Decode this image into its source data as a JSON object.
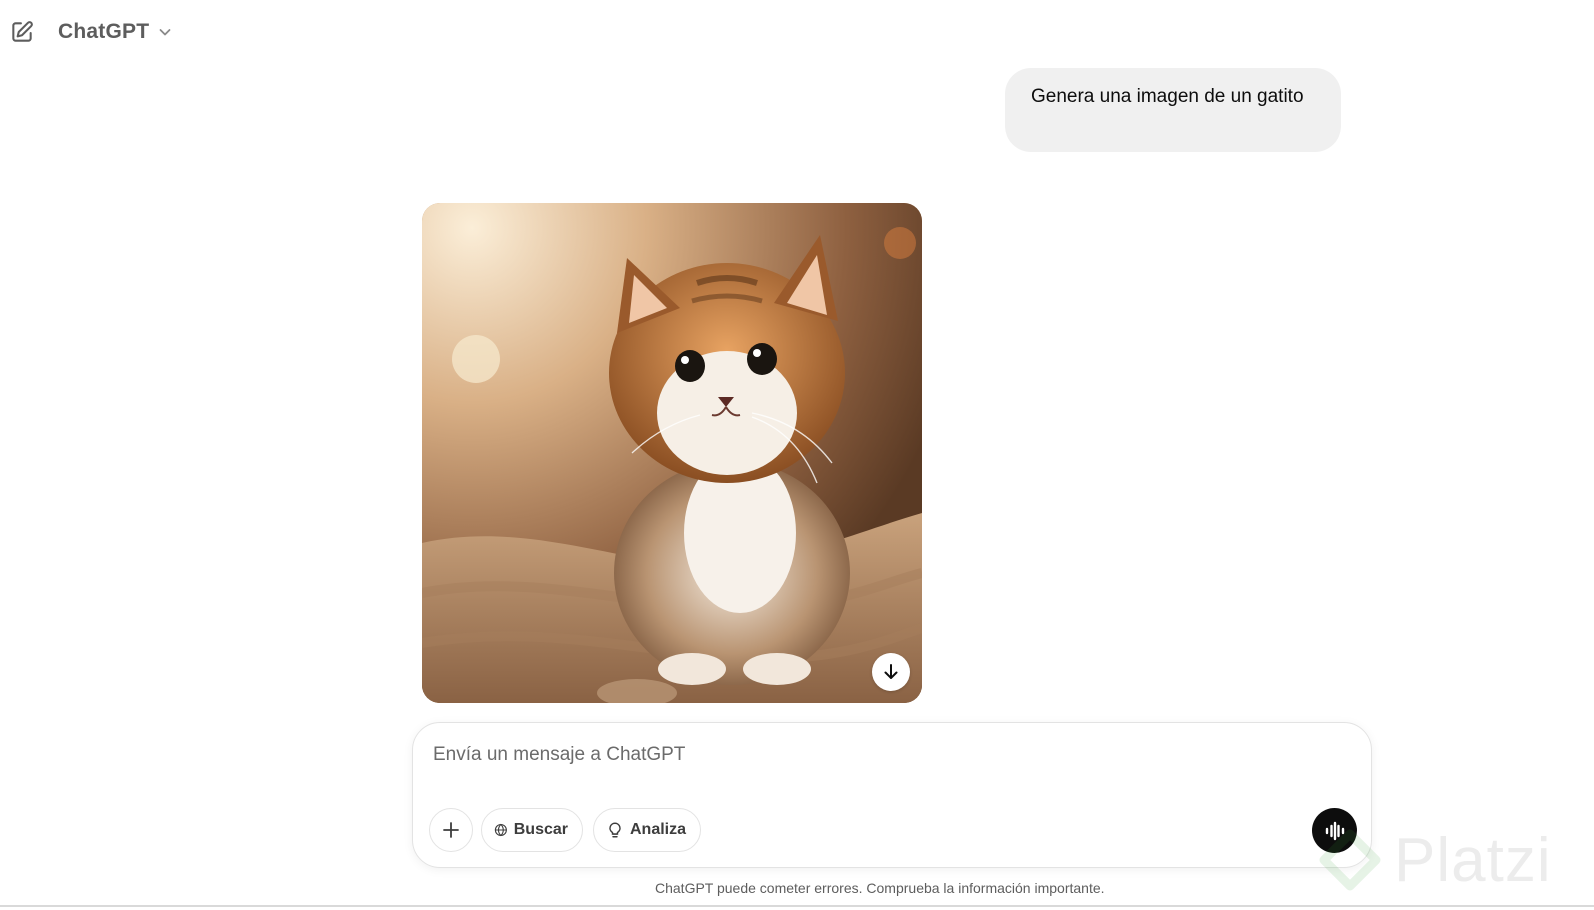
{
  "header": {
    "model_name": "ChatGPT",
    "new_chat_icon": "edit-pencil-icon",
    "chevron_icon": "chevron-down-icon"
  },
  "conversation": {
    "user_message": "Genera una imagen de un gatito",
    "image": {
      "subject": "kitten",
      "download_icon": "arrow-down-icon"
    }
  },
  "composer": {
    "placeholder": "Envía un mensaje a ChatGPT",
    "attach_icon": "plus-icon",
    "buttons": [
      {
        "label": "Buscar",
        "icon": "globe-icon"
      },
      {
        "label": "Analiza",
        "icon": "lightbulb-icon"
      }
    ],
    "voice_icon": "voice-waveform-icon"
  },
  "footer": {
    "disclaimer": "ChatGPT puede cometer errores. Comprueba la información importante."
  },
  "watermark": {
    "text": "Platzi"
  },
  "colors": {
    "bubble_bg": "#f0f0f0",
    "voice_btn": "#0d0d0d",
    "border": "#e3e3e3"
  }
}
